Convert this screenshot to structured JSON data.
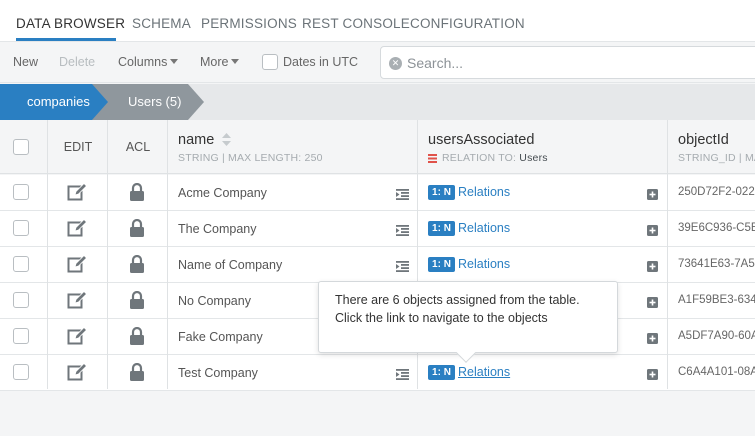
{
  "nav": {
    "tabs": [
      {
        "label": "DATA BROWSER"
      },
      {
        "label": "SCHEMA"
      },
      {
        "label": "PERMISSIONS"
      },
      {
        "label": "REST CONSOLE"
      },
      {
        "label": "CONFIGURATION"
      }
    ],
    "active": "DATA BROWSER"
  },
  "toolbar": {
    "new_label": "New",
    "delete_label": "Delete",
    "columns_label": "Columns",
    "more_label": "More",
    "utc_label": "Dates in UTC",
    "search_placeholder": "Search..."
  },
  "breadcrumb": {
    "items": [
      {
        "label": "companies"
      },
      {
        "label": "Users (5)"
      }
    ]
  },
  "table": {
    "headers": {
      "edit": "EDIT",
      "acl": "ACL",
      "name": {
        "title": "name",
        "sub": "STRING | MAX LENGTH: 250"
      },
      "users": {
        "title": "usersAssociated",
        "sub_prefix": "RELATION TO:",
        "sub_target": "Users"
      },
      "objectid": {
        "title": "objectId",
        "sub": "STRING_ID | MA"
      }
    },
    "relation_badge": "1: N",
    "relation_link": "Relations",
    "rows": [
      {
        "name": "Acme Company",
        "objectId": "250D72F2-022"
      },
      {
        "name": "The Company",
        "objectId": "39E6C936-C5E"
      },
      {
        "name": "Name of Company",
        "objectId": "73641E63-7A5"
      },
      {
        "name": "No Company",
        "objectId": "A1F59BE3-634"
      },
      {
        "name": "Fake Company",
        "objectId": "A5DF7A90-60A"
      },
      {
        "name": "Test Company",
        "objectId": "C6A4A101-08A"
      }
    ]
  },
  "tooltip": {
    "text": "There are 6 objects assigned from the table. Click the link to navigate to the objects"
  },
  "colors": {
    "accent": "#2a7fc2",
    "breadcrumb_dark": "#8f979d",
    "relation_red": "#e0524a"
  }
}
